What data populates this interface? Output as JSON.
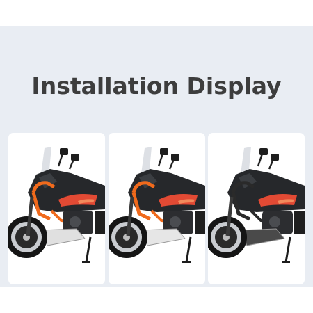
{
  "section": {
    "title": "Installation Display"
  },
  "gallery": {
    "items": [
      {
        "guard_color": "#f06a1c",
        "plate_color": "#e0e0e0"
      },
      {
        "guard_color": "#f06a1c",
        "plate_color": "#e6e6e6"
      },
      {
        "guard_color": "#2a2a2a",
        "plate_color": "#4a4a4a"
      }
    ]
  }
}
